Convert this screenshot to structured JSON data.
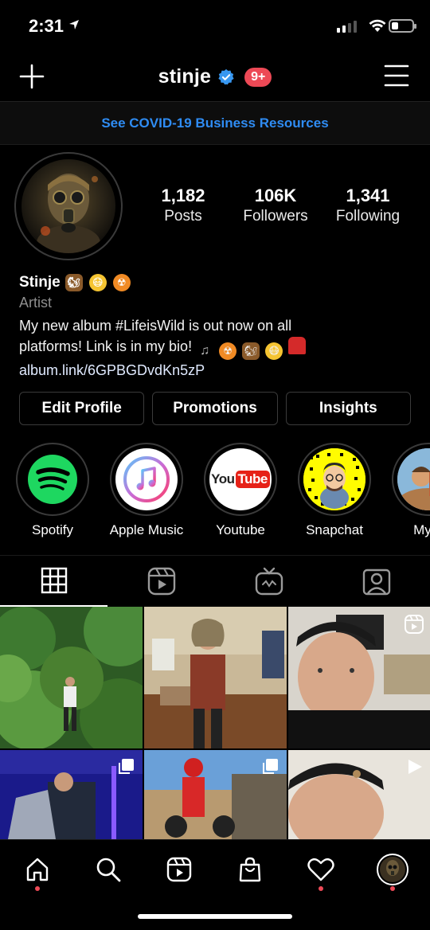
{
  "status_bar": {
    "time": "2:31"
  },
  "header": {
    "username": "stinje",
    "notification_badge": "9+"
  },
  "banner": {
    "text": "See COVID-19 Business Resources"
  },
  "stats": [
    {
      "value": "1,182",
      "label": "Posts"
    },
    {
      "value": "106K",
      "label": "Followers"
    },
    {
      "value": "1,341",
      "label": "Following"
    }
  ],
  "bio": {
    "name": "Stinje",
    "category": "Artist",
    "line1": "My new album #LifeisWild is out now on all",
    "line2": "platforms!  Link is in my bio!",
    "link": "album.link/6GPBGDvdKn5zP"
  },
  "buttons": {
    "edit_profile": "Edit Profile",
    "promotions": "Promotions",
    "insights": "Insights"
  },
  "highlights": [
    {
      "label": "Spotify"
    },
    {
      "label": "Apple Music"
    },
    {
      "label": "Youtube"
    },
    {
      "label": "Snapchat"
    },
    {
      "label": "My A"
    }
  ],
  "youtube_logo": {
    "you": "You",
    "tube": "Tube"
  },
  "colors": {
    "accent_blue": "#2f8cf3",
    "notification_red": "#ed4956",
    "spotify_green": "#1ed760",
    "snapchat_yellow": "#fffc00"
  }
}
